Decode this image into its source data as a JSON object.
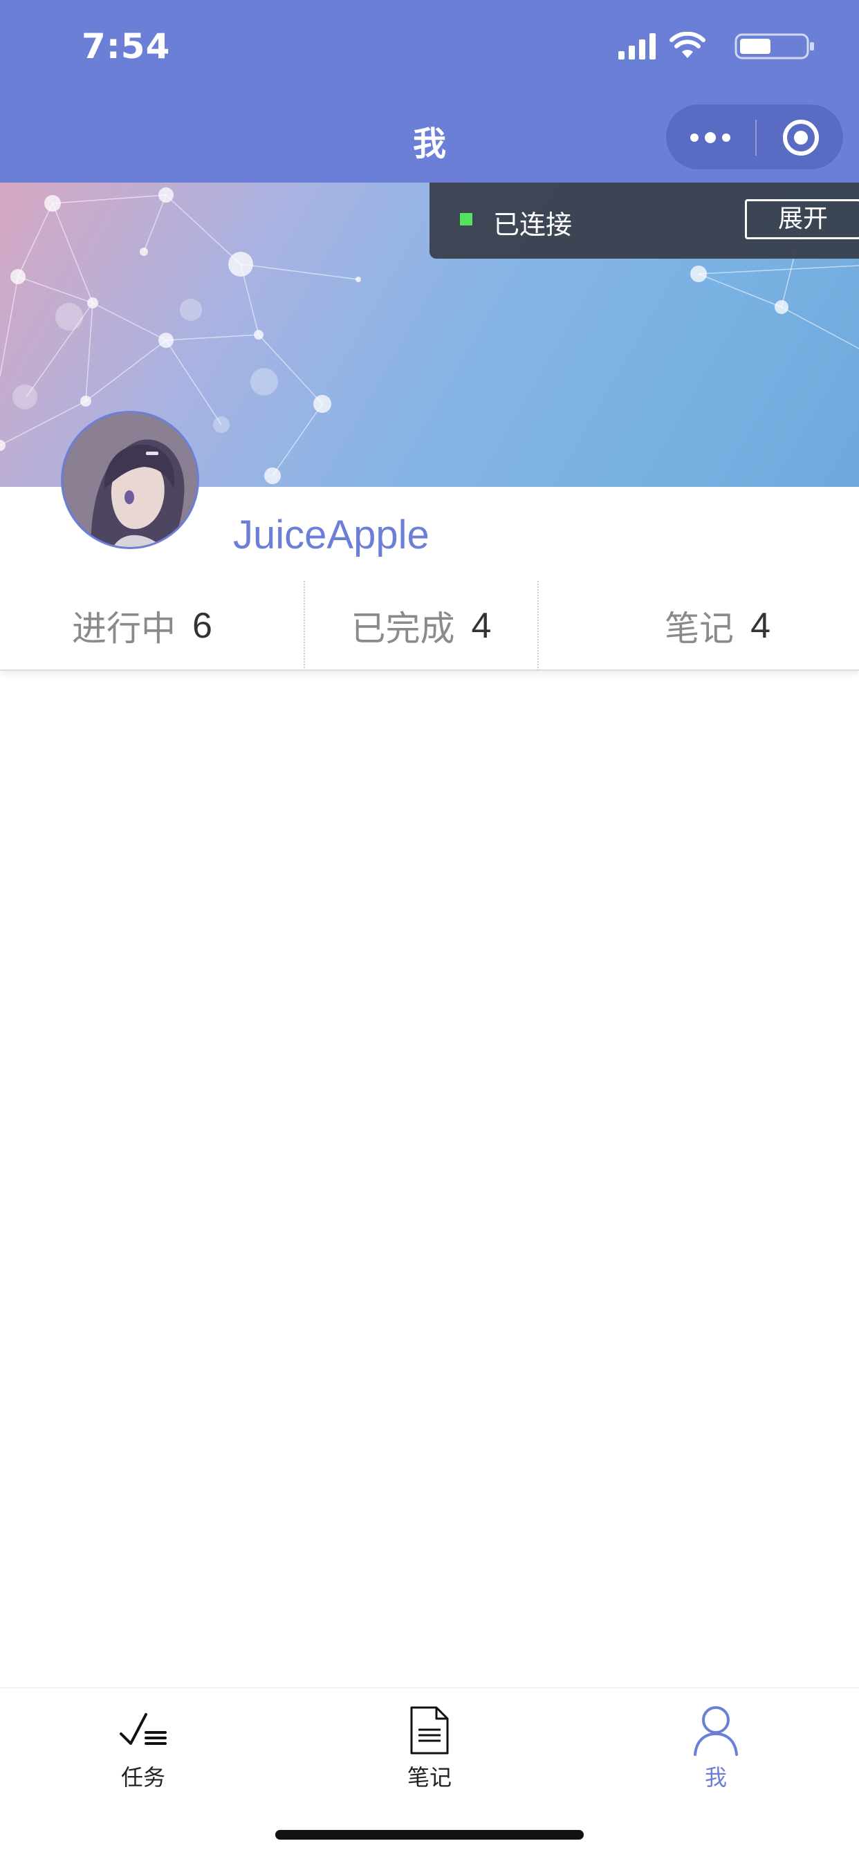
{
  "status_bar": {
    "time": "7:54"
  },
  "header": {
    "title": "我",
    "background_color": "#6b7fd7"
  },
  "capsule": {
    "more_icon": "more-dots-icon",
    "close_icon": "target-circle-icon"
  },
  "connection_toast": {
    "status_text": "已连接",
    "expand_label": "展开",
    "indicator_color": "#55e15f"
  },
  "profile": {
    "username": "JuiceApple",
    "avatar": "anime-girl-avatar"
  },
  "stats": [
    {
      "label": "进行中",
      "value": "6"
    },
    {
      "label": "已完成",
      "value": "4"
    },
    {
      "label": "笔记",
      "value": "4"
    }
  ],
  "tabbar": {
    "items": [
      {
        "label": "任务",
        "icon": "task-checklist-icon",
        "active": false
      },
      {
        "label": "笔记",
        "icon": "document-icon",
        "active": false
      },
      {
        "label": "我",
        "icon": "person-icon",
        "active": true
      }
    ],
    "active_color": "#6b7fd7"
  }
}
